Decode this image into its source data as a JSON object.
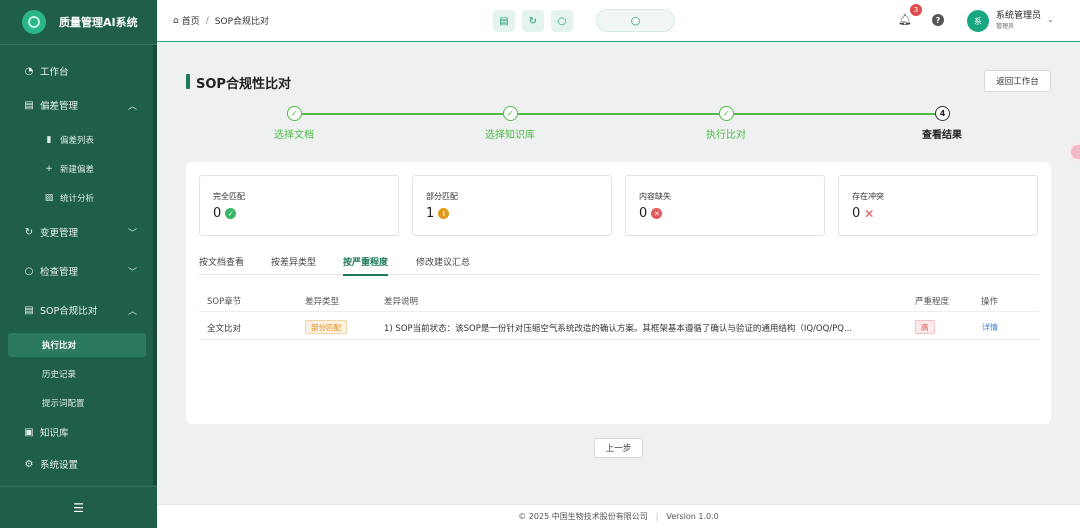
{
  "app": {
    "title": "质量管理AI系统"
  },
  "sidebar": {
    "items": [
      {
        "label": "工作台",
        "icon": "dashboard-icon"
      },
      {
        "label": "偏差管理",
        "icon": "document-icon"
      },
      {
        "label": "变更管理",
        "icon": "refresh-icon"
      },
      {
        "label": "检查管理",
        "icon": "search-icon"
      },
      {
        "label": "SOP合规比对",
        "icon": "document-icon"
      },
      {
        "label": "知识库",
        "icon": "book-icon"
      },
      {
        "label": "系统设置",
        "icon": "gear-icon"
      }
    ],
    "deviation_sub": [
      "偏差列表",
      "新建偏差",
      "统计分析"
    ],
    "sop_sub": [
      "执行比对",
      "历史记录",
      "提示词配置"
    ]
  },
  "header": {
    "breadcrumb_home": "首页",
    "breadcrumb_current": "SOP合规比对",
    "notification_count": "3",
    "user_name": "系统管理员",
    "user_role": "管理员",
    "avatar_text": "系"
  },
  "page": {
    "title": "SOP合规性比对",
    "back_label": "返回工作台",
    "prev_label": "上一步"
  },
  "steps": [
    {
      "label": "选择文档",
      "state": "done"
    },
    {
      "label": "选择知识库",
      "state": "done"
    },
    {
      "label": "执行比对",
      "state": "done"
    },
    {
      "label": "查看结果",
      "state": "current",
      "number": "4"
    }
  ],
  "stats": [
    {
      "title": "完全匹配",
      "value": "0",
      "status": "success"
    },
    {
      "title": "部分匹配",
      "value": "1",
      "status": "warning"
    },
    {
      "title": "内容缺失",
      "value": "0",
      "status": "error"
    },
    {
      "title": "存在冲突",
      "value": "0",
      "status": "conflict"
    }
  ],
  "tabs": [
    "按文档查看",
    "按差异类型",
    "按严重程度",
    "修改建议汇总"
  ],
  "active_tab": "按严重程度",
  "table": {
    "headers": [
      "SOP章节",
      "差异类型",
      "差异说明",
      "严重程度",
      "操作"
    ],
    "rows": [
      {
        "section": "全文比对",
        "type": "部分匹配",
        "description": "1) SOP当前状态：该SOP是一份针对压缩空气系统改造的确认方案。其框架基本遵循了确认与验证的通用结构（IQ/OQ/PQ...",
        "severity": "高",
        "action": "详情"
      }
    ]
  },
  "footer": {
    "copyright": "© 2025 中国生物技术股份有限公司",
    "version": "Version 1.0.0"
  },
  "colors": {
    "primary": "#1f5f49",
    "accent": "#4fb94a",
    "link": "#3f7fd6"
  }
}
